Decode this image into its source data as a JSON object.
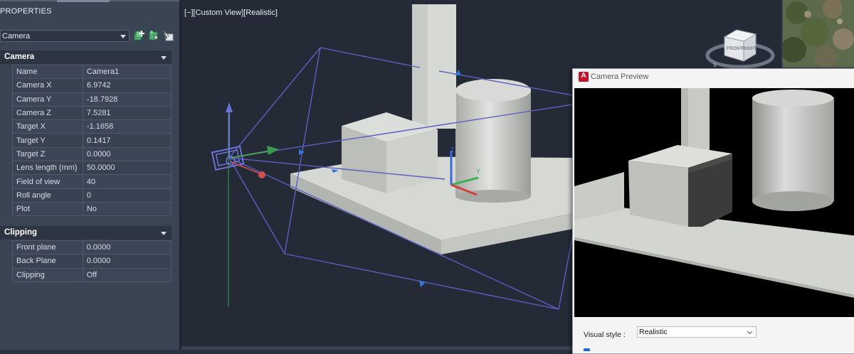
{
  "palette": {
    "title": "PROPERTIES",
    "object_type": "Camera",
    "tool_icons": [
      "add-selected-icon",
      "quick-select-icon",
      "toggle-pickadd-icon"
    ],
    "sections": {
      "camera": {
        "title": "Camera",
        "rows": [
          {
            "label": "Name",
            "value": "Camera1"
          },
          {
            "label": "Camera X",
            "value": "6.9742"
          },
          {
            "label": "Camera Y",
            "value": "-18.7928"
          },
          {
            "label": "Camera Z",
            "value": "7.5281"
          },
          {
            "label": "Target X",
            "value": "-1.1658"
          },
          {
            "label": "Target Y",
            "value": "0.1417"
          },
          {
            "label": "Target Z",
            "value": "0.0000"
          },
          {
            "label": "Lens length (mm)",
            "value": "50.0000"
          },
          {
            "label": "Field of view",
            "value": "40"
          },
          {
            "label": "Roll angle",
            "value": "0"
          },
          {
            "label": "Plot",
            "value": "No"
          }
        ]
      },
      "clipping": {
        "title": "Clipping",
        "rows": [
          {
            "label": "Front plane",
            "value": "0.0000"
          },
          {
            "label": "Back Plane",
            "value": "0.0000"
          },
          {
            "label": "Clipping",
            "value": "Off"
          }
        ]
      }
    }
  },
  "viewport": {
    "label": "[−][Custom View][Realistic]",
    "viewcube": {
      "front": "FRONT",
      "right": "RIGHT",
      "compass_s": "S"
    }
  },
  "preview": {
    "app_icon": "A",
    "title": "Camera Preview",
    "visual_style_label": "Visual style :",
    "visual_style_value": "Realistic"
  },
  "colors": {
    "palette_bg": "#3b4453",
    "viewport_bg": "#252b36",
    "camera_glyph": "#6b72d8",
    "frustum": "#5b5fc0",
    "model_light": "#d4d6d2",
    "model_mid": "#b9bbb7",
    "model_dark": "#8e908c",
    "preview_bg": "#f4f4f4",
    "app_red": "#c8102e"
  }
}
